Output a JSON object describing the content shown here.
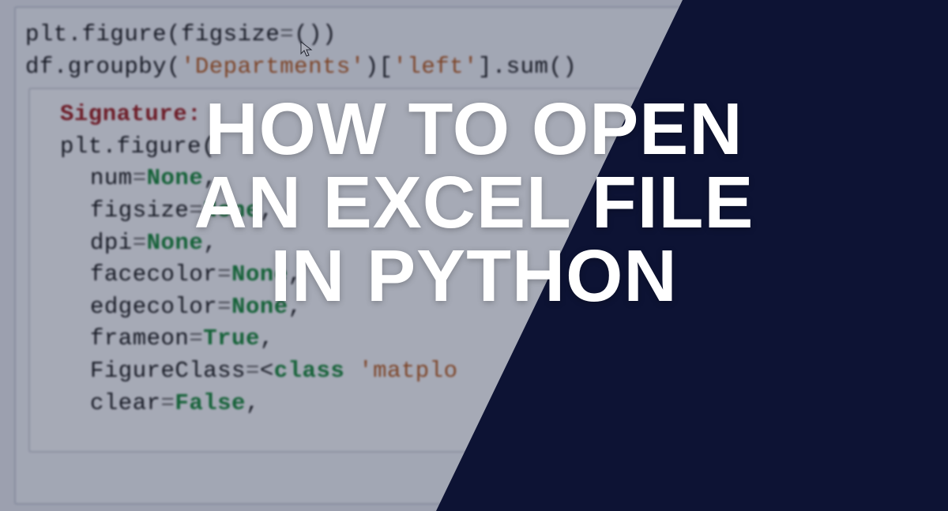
{
  "headline": {
    "line1": "HOW TO OPEN",
    "line2": "AN EXCEL FILE",
    "line3": "IN PYTHON"
  },
  "code": {
    "top_line_parts": {
      "a": "plt",
      "b": ".",
      "c": "figure",
      "d": "(",
      "e": "figsize",
      "f": "=",
      "g": "(",
      "h": ")",
      "i": ")"
    },
    "second_line_parts": {
      "a": "df",
      "b": ".",
      "c": "groupby",
      "d": "(",
      "e": "'Departments'",
      "f": ")[",
      "g": "'left'",
      "h": "]",
      "i": ".sum()"
    },
    "tooltip": {
      "sig_label": "Signature:",
      "call_parts": {
        "a": "plt",
        "b": ".",
        "c": "figure",
        "d": "("
      },
      "params": [
        {
          "name": "num",
          "eq": "=",
          "val": "None",
          "comma": ","
        },
        {
          "name": "figsize",
          "eq": "=",
          "val": "None",
          "comma": ","
        },
        {
          "name": "dpi",
          "eq": "=",
          "val": "None",
          "comma": ","
        },
        {
          "name": "facecolor",
          "eq": "=",
          "val": "None",
          "comma": ","
        },
        {
          "name": "edgecolor",
          "eq": "=",
          "val": "None",
          "comma": ","
        },
        {
          "name": "frameon",
          "eq": "=",
          "val": "True",
          "comma": ","
        }
      ],
      "figclass": {
        "name": "FigureClass",
        "eq": "=",
        "lt": "<",
        "cls": "class",
        "sp": " ",
        "str": "'matplo",
        "tail": ""
      },
      "clear": {
        "name": "clear",
        "eq": "=",
        "val": "False",
        "comma": ","
      }
    }
  }
}
